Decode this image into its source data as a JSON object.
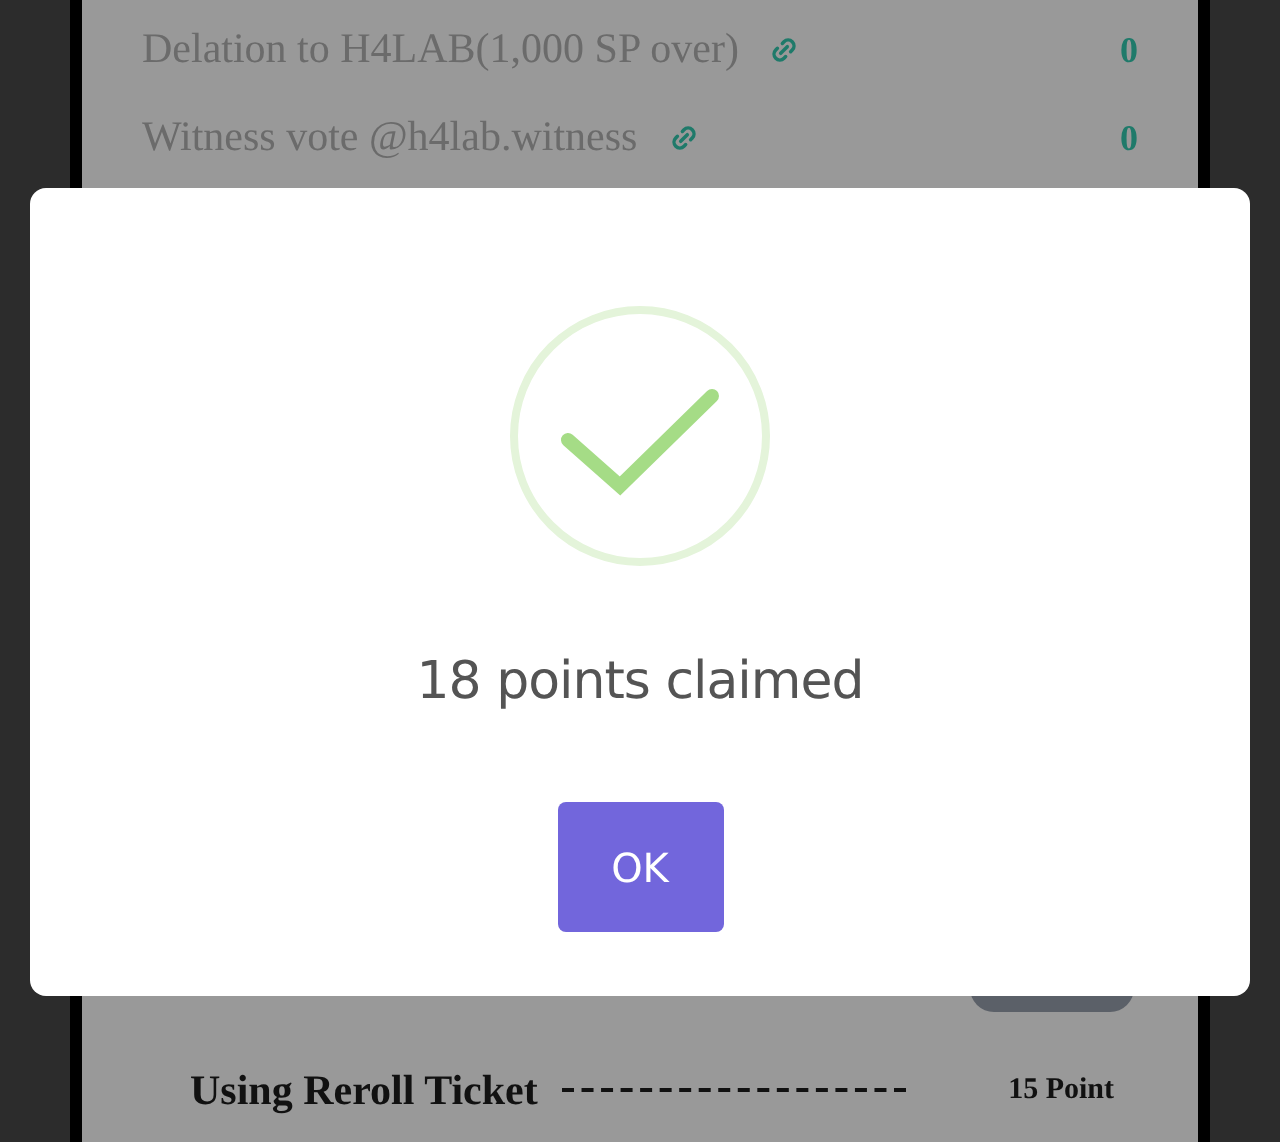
{
  "tasks": [
    {
      "label": "Delation to H4LAB(1,000 SP over)",
      "points": "0"
    },
    {
      "label": "Witness vote @h4lab.witness",
      "points": "0"
    }
  ],
  "dialog": {
    "message": "18 points claimed",
    "button": "OK"
  },
  "costs": [
    {
      "label": "Using Reroll Ticket",
      "points": "15 Point"
    }
  ]
}
